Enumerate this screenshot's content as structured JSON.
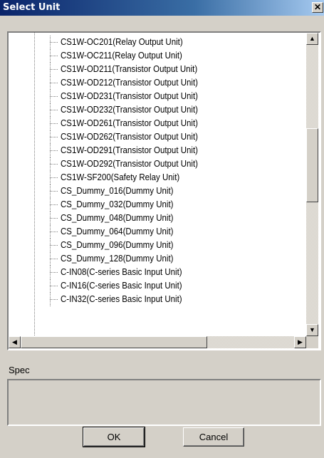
{
  "window": {
    "title": "Select Unit",
    "close_glyph": "✕"
  },
  "tree": {
    "items": [
      "CS1W-OC201(Relay Output Unit)",
      "CS1W-OC211(Relay Output Unit)",
      "CS1W-OD211(Transistor Output Unit)",
      "CS1W-OD212(Transistor Output Unit)",
      "CS1W-OD231(Transistor Output Unit)",
      "CS1W-OD232(Transistor Output Unit)",
      "CS1W-OD261(Transistor Output Unit)",
      "CS1W-OD262(Transistor Output Unit)",
      "CS1W-OD291(Transistor Output Unit)",
      "CS1W-OD292(Transistor Output Unit)",
      "CS1W-SF200(Safety Relay Unit)",
      "CS_Dummy_016(Dummy Unit)",
      "CS_Dummy_032(Dummy Unit)",
      "CS_Dummy_048(Dummy Unit)",
      "CS_Dummy_064(Dummy Unit)",
      "CS_Dummy_096(Dummy Unit)",
      "CS_Dummy_128(Dummy Unit)",
      "C-IN08(C-series Basic Input Unit)",
      "C-IN16(C-series Basic Input Unit)",
      "C-IN32(C-series Basic Input Unit)"
    ],
    "scroll_up_glyph": "▲",
    "scroll_down_glyph": "▼",
    "scroll_left_glyph": "◀",
    "scroll_right_glyph": "▶"
  },
  "spec": {
    "label": "Spec",
    "value": ""
  },
  "buttons": {
    "ok_label": "OK",
    "cancel_label": "Cancel"
  }
}
